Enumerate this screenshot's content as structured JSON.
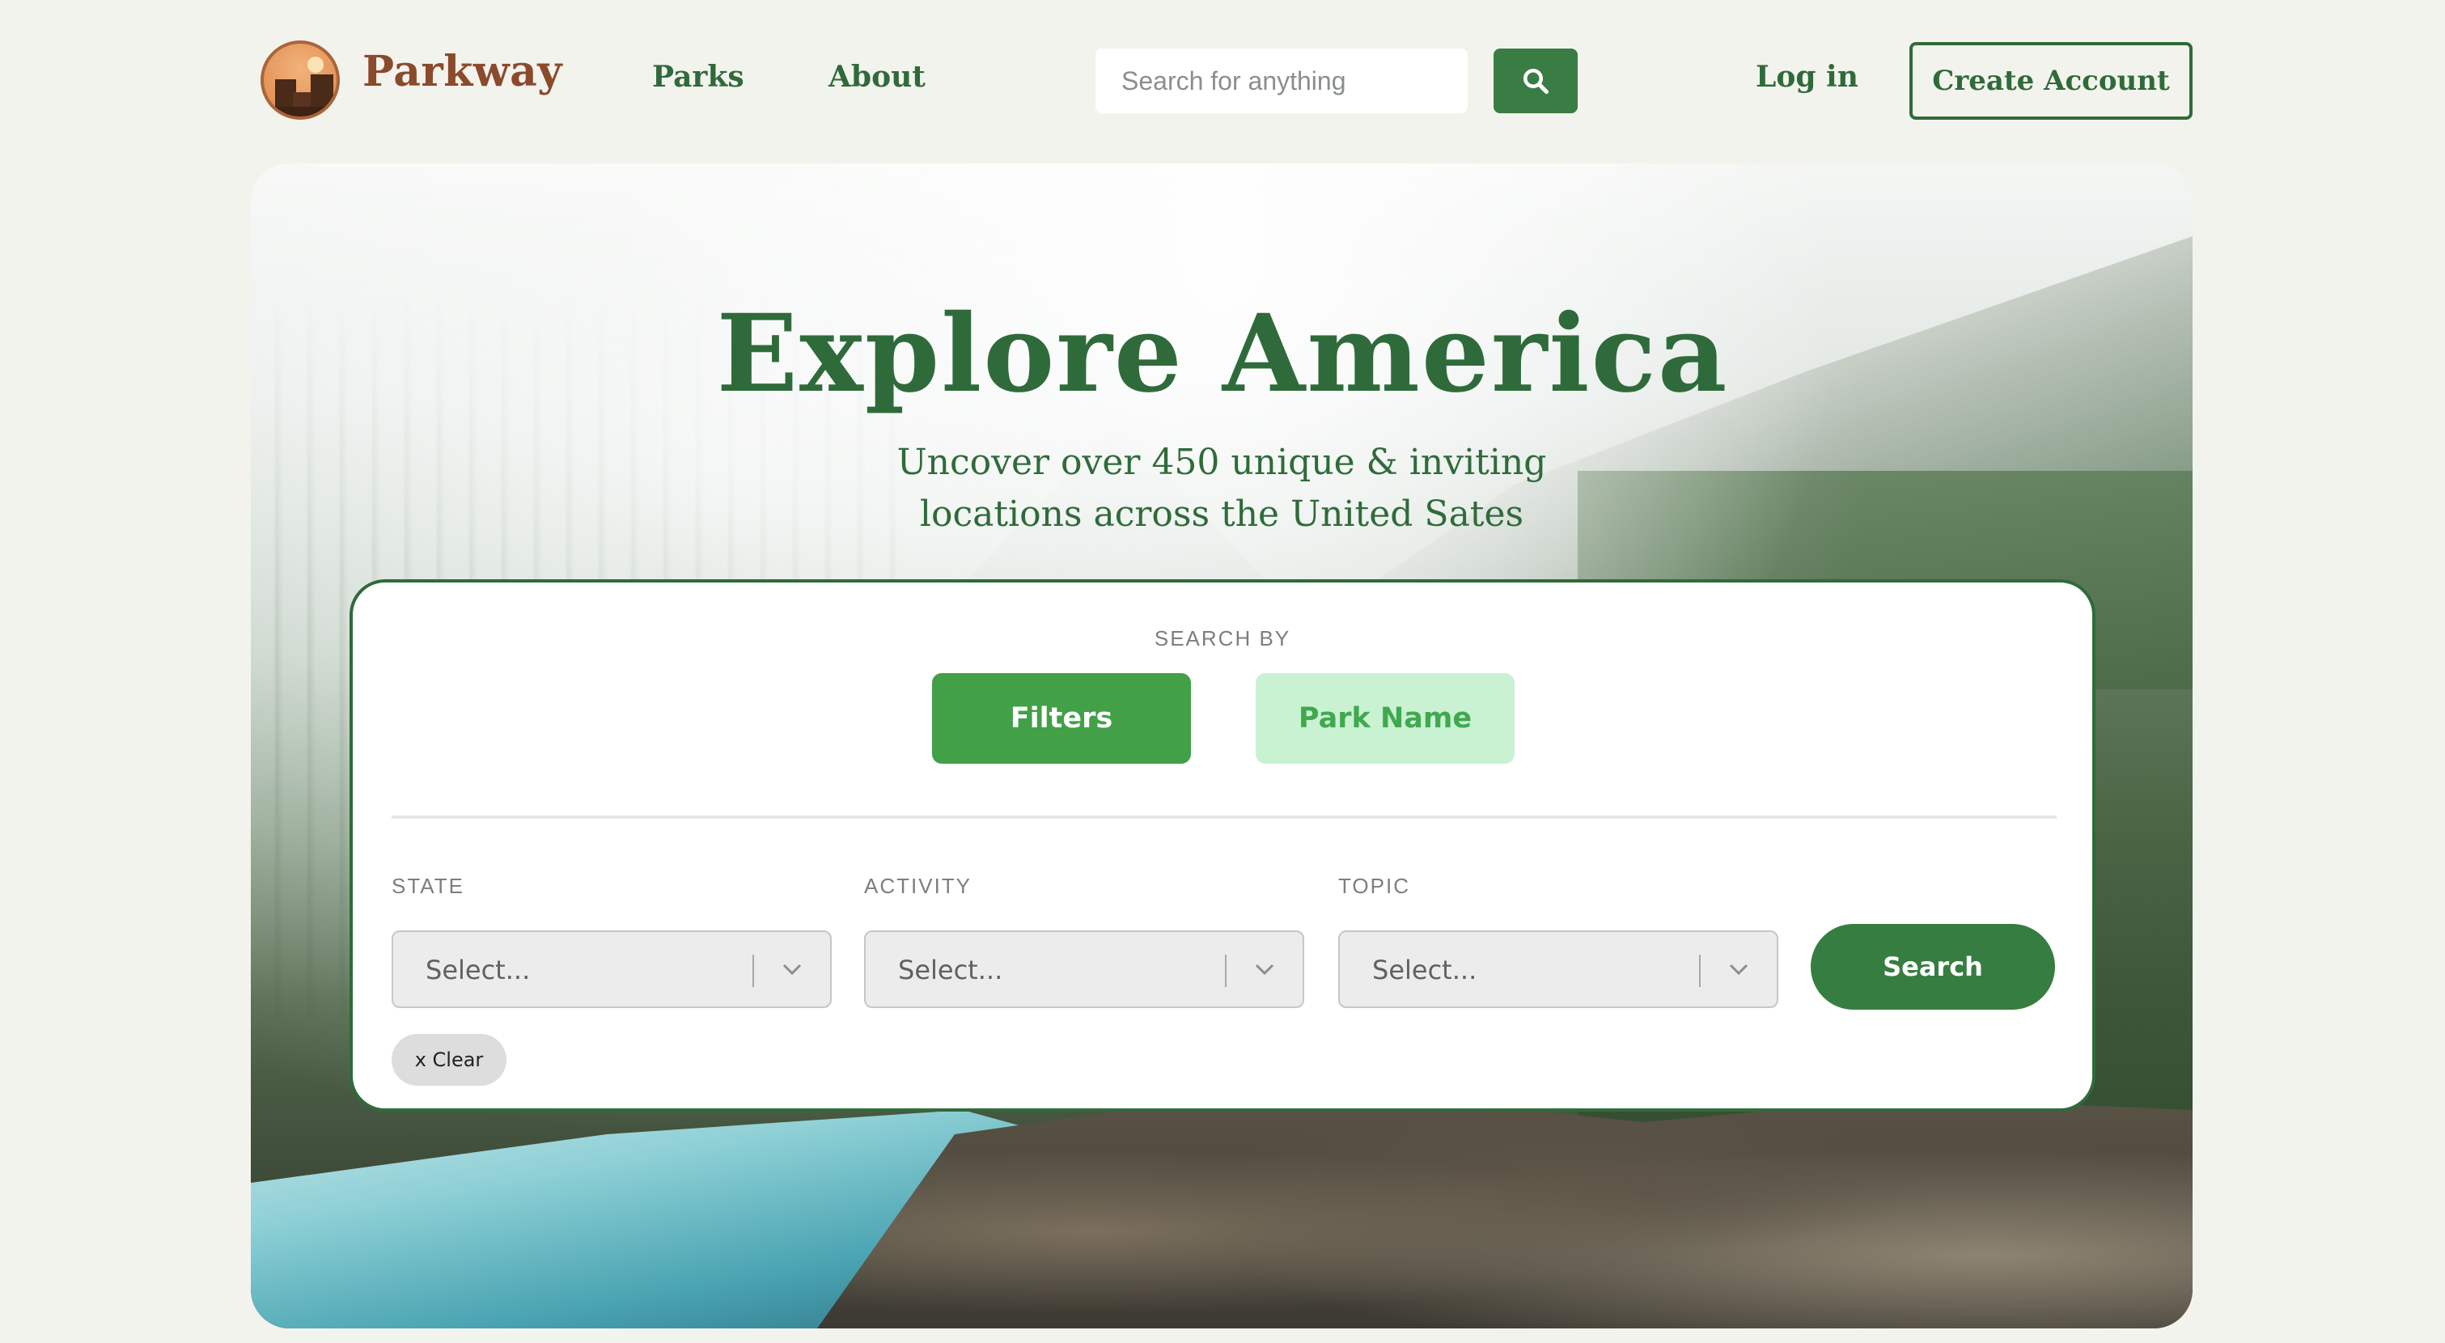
{
  "header": {
    "brand": "Parkway",
    "nav": {
      "parks": "Parks",
      "about": "About"
    },
    "search": {
      "placeholder": "Search for anything",
      "value": ""
    },
    "login": "Log in",
    "create_account": "Create Account"
  },
  "hero": {
    "title": "Explore America",
    "subtitle": "Uncover over 450 unique & inviting locations across the United Sates"
  },
  "search_card": {
    "search_by_label": "SEARCH BY",
    "toggles": {
      "filters": "Filters",
      "park_name": "Park Name"
    },
    "fields": {
      "state": {
        "label": "STATE",
        "value": "Select..."
      },
      "activity": {
        "label": "ACTIVITY",
        "value": "Select..."
      },
      "topic": {
        "label": "TOPIC",
        "value": "Select..."
      }
    },
    "search_button": "Search",
    "clear_button": "x Clear"
  },
  "colors": {
    "primary_green": "#2f6b3a",
    "button_green": "#367d41",
    "toggle_active": "#42a047",
    "toggle_inactive": "#c9f2d3",
    "brand_brown": "#8a4a2b",
    "page_bg": "#f3f3ee"
  },
  "icons": {
    "search_button": "search-icon",
    "select_chevron": "chevron-down-icon",
    "logo": "canyon-sun-logo-icon"
  }
}
